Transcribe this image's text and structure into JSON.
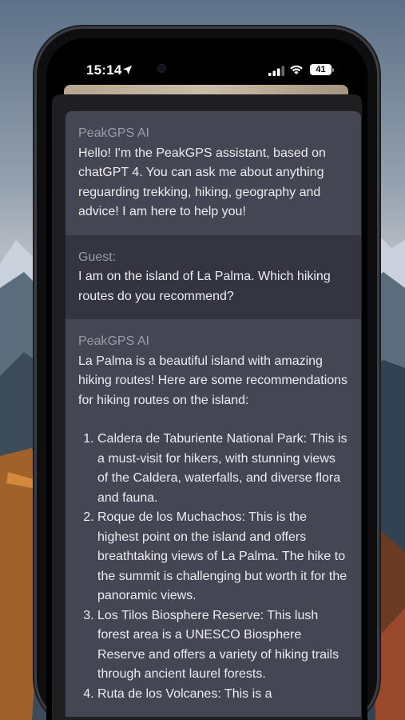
{
  "status_bar": {
    "time": "15:14",
    "battery": "41"
  },
  "colors": {
    "ai_bubble": "#444654",
    "user_bubble": "#343541",
    "sender_text": "#9c9ca6"
  },
  "chat": {
    "messages": [
      {
        "sender": "PeakGPS AI",
        "text": "Hello! I'm the PeakGPS assistant, based on chatGPT 4. You can ask me about anything reguarding trekking, hiking, geography and advice! I am here to help you!"
      },
      {
        "sender": "Guest:",
        "text": "I am on the island of La Palma. Which hiking routes do you recommend?"
      },
      {
        "sender": "PeakGPS AI",
        "text": "La Palma is a beautiful island with amazing hiking routes! Here are some recommendations for hiking routes on the island:",
        "list": [
          "Caldera de Taburiente National Park: This is a must-visit for hikers, with stunning views of the Caldera, waterfalls, and diverse flora and fauna.",
          "Roque de los Muchachos: This is the highest point on the island and offers breathtaking views of La Palma. The hike to the summit is challenging but worth it for the panoramic views.",
          "Los Tilos Biosphere Reserve: This lush forest area is a UNESCO Biosphere Reserve and offers a variety of hiking trails through ancient laurel forests.",
          "Ruta de los Volcanes: This is a"
        ]
      }
    ]
  }
}
